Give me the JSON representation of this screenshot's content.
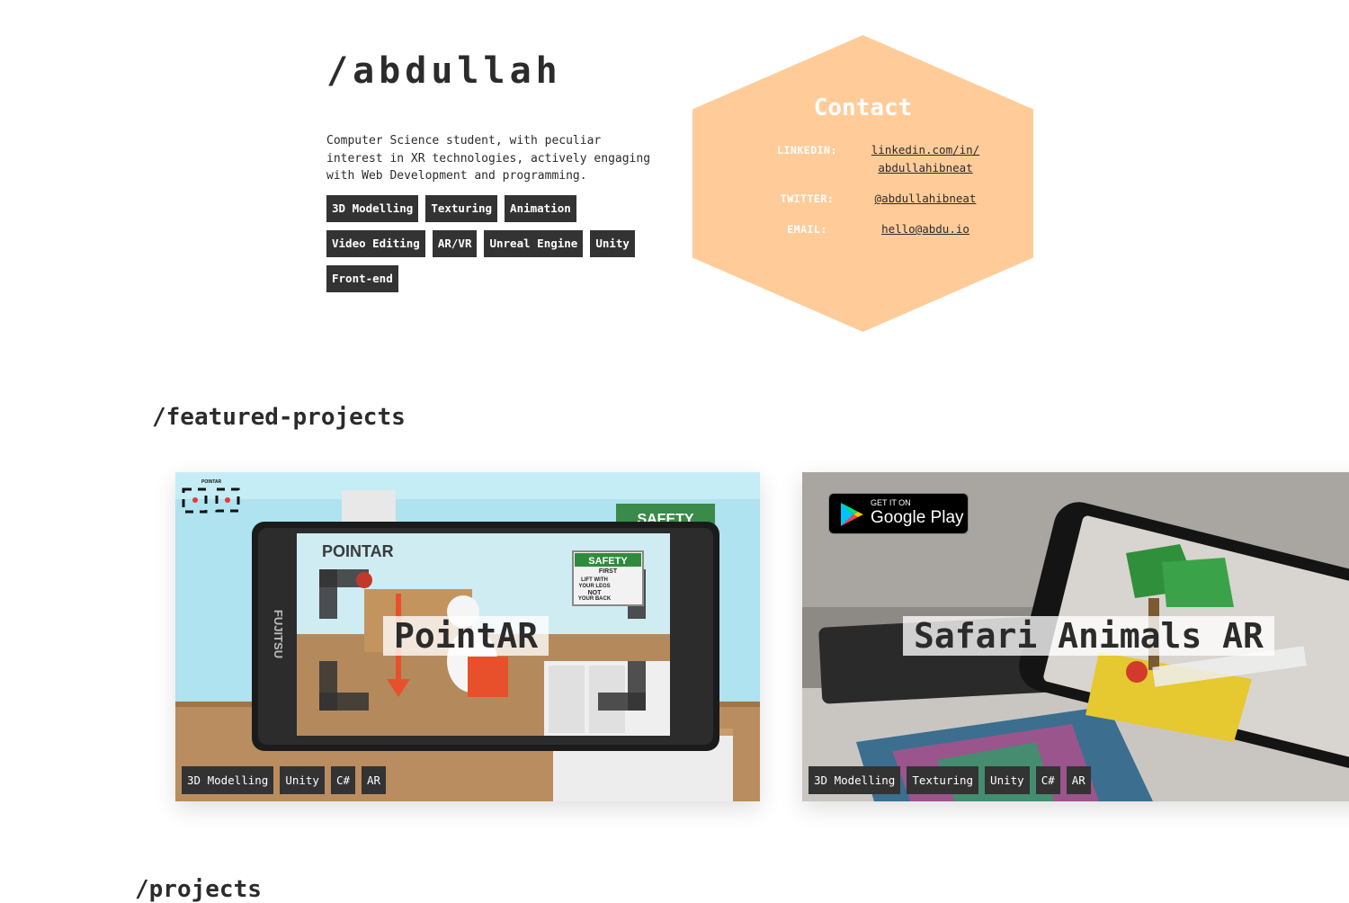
{
  "header": {
    "title": "/abdullah",
    "bio": "Computer Science student, with peculiar interest in XR technologies, actively engaging with Web Development and programming.",
    "skills": [
      "3D Modelling",
      "Texturing",
      "Animation",
      "Video Editing",
      "AR/VR",
      "Unreal Engine",
      "Unity",
      "Front-end"
    ]
  },
  "contact": {
    "title": "Contact",
    "linkedin_label": "LINKEDIN:",
    "linkedin_line1": "linkedin.com/in/",
    "linkedin_line2": "abdullahibneat",
    "twitter_label": "TWITTER:",
    "twitter_value": "@abdullahibneat",
    "email_label": "EMAIL:",
    "email_value": "hello@abdu.io",
    "background_color": "#ffcc99"
  },
  "featured": {
    "title": "/featured-projects",
    "projects": [
      {
        "title": "PointAR",
        "tags": [
          "3D Modelling",
          "Unity",
          "C#",
          "AR"
        ],
        "image_texts": {
          "app_logo": "POINTAR",
          "tiny_logo": "POINTAR",
          "phone_brand": "FUJITSU",
          "sign_heading": "SAFETY",
          "sign_sub": "FIRST",
          "sign_line1": "LIFT WITH",
          "sign_line2": "YOUR LEGS",
          "sign_line3": "NOT",
          "sign_line4": "YOUR BACK",
          "background_sign": "SAFETY"
        }
      },
      {
        "title": "Safari Animals AR",
        "tags": [
          "3D Modelling",
          "Texturing",
          "Unity",
          "C#",
          "AR"
        ],
        "store_badge": {
          "small": "GET IT ON",
          "large": "Google Play"
        }
      }
    ]
  },
  "projects_section": {
    "title": "/projects"
  },
  "colors": {
    "tag_background": "#333333",
    "text": "#2b2b2b",
    "accent": "#ffcc99"
  }
}
